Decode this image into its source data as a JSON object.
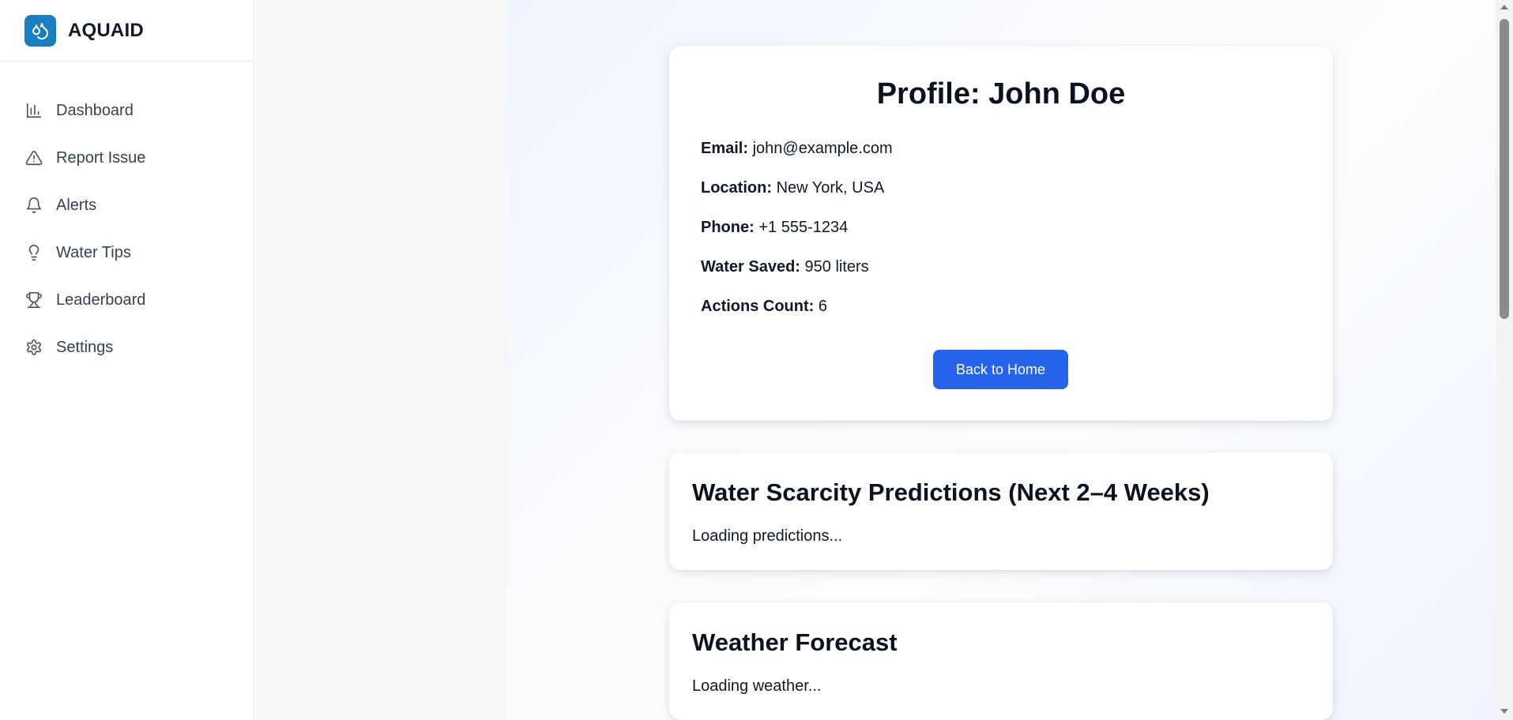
{
  "app": {
    "name": "AQUAID",
    "logo_icon": "water-drops-icon",
    "brand_color": "#1a7fc1"
  },
  "sidebar": {
    "items": [
      {
        "label": "Dashboard",
        "icon": "bar-chart-icon"
      },
      {
        "label": "Report Issue",
        "icon": "warning-triangle-icon"
      },
      {
        "label": "Alerts",
        "icon": "bell-icon"
      },
      {
        "label": "Water Tips",
        "icon": "lightbulb-icon"
      },
      {
        "label": "Leaderboard",
        "icon": "trophy-icon"
      },
      {
        "label": "Settings",
        "icon": "gear-icon"
      }
    ]
  },
  "profile": {
    "title": "Profile: John Doe",
    "fields": [
      {
        "label": "Email:",
        "value": "john@example.com"
      },
      {
        "label": "Location:",
        "value": "New York, USA"
      },
      {
        "label": "Phone:",
        "value": "+1 555-1234"
      },
      {
        "label": "Water Saved:",
        "value": "950 liters"
      },
      {
        "label": "Actions Count:",
        "value": "6"
      }
    ],
    "back_button": "Back to Home",
    "accent_color": "#2563eb"
  },
  "predictions": {
    "title": "Water Scarcity Predictions (Next 2–4 Weeks)",
    "status": "Loading predictions..."
  },
  "weather": {
    "title": "Weather Forecast",
    "status": "Loading weather..."
  }
}
